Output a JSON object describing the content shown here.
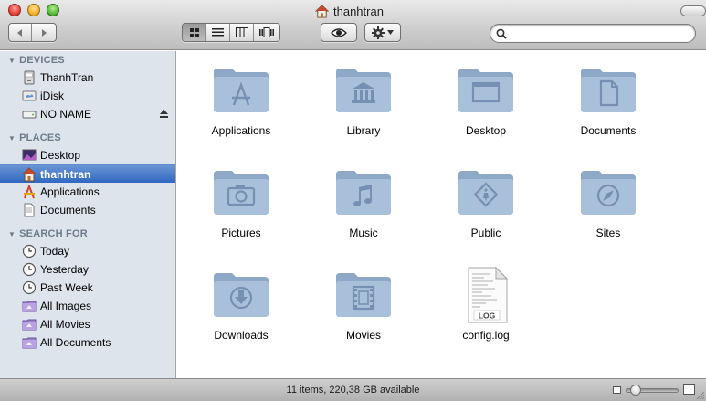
{
  "window": {
    "title": "thanhtran",
    "status_text": "11 items, 220,38 GB available",
    "icon_size_level": 0.1
  },
  "toolbar": {
    "nav": [
      "back-icon",
      "forward-icon"
    ],
    "views": [
      "icon-view",
      "list-view",
      "column-view",
      "coverflow-view"
    ],
    "active_view": "icon-view",
    "quick_look_icon": "eye-icon",
    "action_icon": "gear-icon",
    "search": {
      "value": "",
      "placeholder": ""
    }
  },
  "sidebar": {
    "sections": [
      {
        "header": "DEVICES",
        "items": [
          {
            "label": "ThanhTran",
            "icon": "computer-icon"
          },
          {
            "label": "iDisk",
            "icon": "idisk-icon"
          },
          {
            "label": "NO NAME",
            "icon": "drive-icon",
            "eject": true
          }
        ]
      },
      {
        "header": "PLACES",
        "items": [
          {
            "label": "Desktop",
            "icon": "desktop-icon"
          },
          {
            "label": "thanhtran",
            "icon": "home-icon",
            "selected": true
          },
          {
            "label": "Applications",
            "icon": "applications-icon"
          },
          {
            "label": "Documents",
            "icon": "documents-icon"
          }
        ]
      },
      {
        "header": "SEARCH FOR",
        "items": [
          {
            "label": "Today",
            "icon": "clock-icon"
          },
          {
            "label": "Yesterday",
            "icon": "clock-icon"
          },
          {
            "label": "Past Week",
            "icon": "clock-icon"
          },
          {
            "label": "All Images",
            "icon": "smart-folder-icon"
          },
          {
            "label": "All Movies",
            "icon": "smart-folder-icon"
          },
          {
            "label": "All Documents",
            "icon": "smart-folder-icon"
          }
        ]
      }
    ]
  },
  "files": [
    {
      "label": "Applications",
      "icon": "applications-folder-icon"
    },
    {
      "label": "Library",
      "icon": "library-folder-icon"
    },
    {
      "label": "Desktop",
      "icon": "desktop-folder-icon"
    },
    {
      "label": "Documents",
      "icon": "documents-folder-icon"
    },
    {
      "label": "Pictures",
      "icon": "pictures-folder-icon"
    },
    {
      "label": "Music",
      "icon": "music-folder-icon"
    },
    {
      "label": "Public",
      "icon": "public-folder-icon"
    },
    {
      "label": "Sites",
      "icon": "sites-folder-icon"
    },
    {
      "label": "Downloads",
      "icon": "downloads-folder-icon"
    },
    {
      "label": "Movies",
      "icon": "movies-folder-icon"
    },
    {
      "label": "config.log",
      "icon": "log-file-icon",
      "badge": "LOG"
    }
  ],
  "colors": {
    "sidebar_bg": "#dde4ec",
    "sidebar_header": "#6e7b8b",
    "selection": "#3d74c8",
    "folder_blue": "#9bb3cf"
  }
}
